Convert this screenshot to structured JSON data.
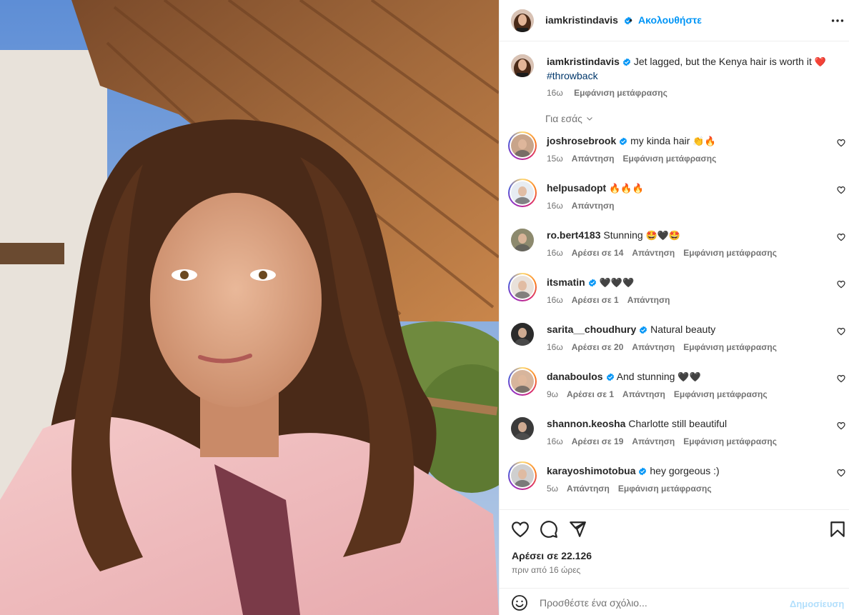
{
  "post": {
    "username": "iamkristindavis",
    "separator": "•",
    "follow_label": "Ακολουθήστε",
    "more_icon": "more-horizontal-icon"
  },
  "caption": {
    "username": "iamkristindavis",
    "text": "Jet lagged, but the Kenya hair is worth it",
    "emoji": "❤️",
    "hashtag": "#throwback",
    "time": "16ω",
    "translation": "Εμφάνιση μετάφρασης"
  },
  "for_you_label": "Για εσάς",
  "comments": [
    {
      "username": "joshrosebrook",
      "verified": true,
      "text": "my kinda hair",
      "emoji": "👏🔥",
      "time": "15ω",
      "likes": "",
      "reply": "Απάντηση",
      "translation": "Εμφάνιση μετάφρασης",
      "ring": true
    },
    {
      "username": "helpusadopt",
      "verified": false,
      "text": "",
      "emoji": "🔥🔥🔥",
      "time": "16ω",
      "likes": "",
      "reply": "Απάντηση",
      "translation": "",
      "ring": true
    },
    {
      "username": "ro.bert4183",
      "verified": false,
      "text": "Stunning",
      "emoji": "🤩🖤🤩",
      "time": "16ω",
      "likes": "Αρέσει σε 14",
      "reply": "Απάντηση",
      "translation": "Εμφάνιση μετάφρασης",
      "ring": false
    },
    {
      "username": "itsmatin",
      "verified": true,
      "text": "",
      "emoji": "🖤🖤🖤",
      "time": "16ω",
      "likes": "Αρέσει σε 1",
      "reply": "Απάντηση",
      "translation": "",
      "ring": true
    },
    {
      "username": "sarita__choudhury",
      "verified": true,
      "text": "Natural beauty",
      "emoji": "",
      "time": "16ω",
      "likes": "Αρέσει σε 20",
      "reply": "Απάντηση",
      "translation": "Εμφάνιση μετάφρασης",
      "ring": false
    },
    {
      "username": "danaboulos",
      "verified": true,
      "text": "And stunning",
      "emoji": "🖤🖤",
      "time": "9ω",
      "likes": "Αρέσει σε 1",
      "reply": "Απάντηση",
      "translation": "Εμφάνιση μετάφρασης",
      "ring": true
    },
    {
      "username": "shannon.keosha",
      "verified": false,
      "text": "Charlotte still beautiful",
      "emoji": "",
      "time": "16ω",
      "likes": "Αρέσει σε 19",
      "reply": "Απάντηση",
      "translation": "Εμφάνιση μετάφρασης",
      "ring": false
    },
    {
      "username": "karayoshimotobua",
      "verified": true,
      "text": "hey gorgeous :)",
      "emoji": "",
      "time": "5ω",
      "likes": "",
      "reply": "Απάντηση",
      "translation": "Εμφάνιση μετάφρασης",
      "ring": true
    }
  ],
  "actions": {
    "likes_label": "Αρέσει σε 22.126",
    "time_ago": "πριν από 16 ώρες"
  },
  "add_comment": {
    "placeholder": "Προσθέστε ένα σχόλιο...",
    "post_label": "Δημοσίευση"
  },
  "colors": {
    "accent": "#0095f6",
    "verified": "#0095f6",
    "text": "#262626",
    "secondary": "#737373",
    "hashtag": "#00376b",
    "heart": "#ed4956"
  }
}
